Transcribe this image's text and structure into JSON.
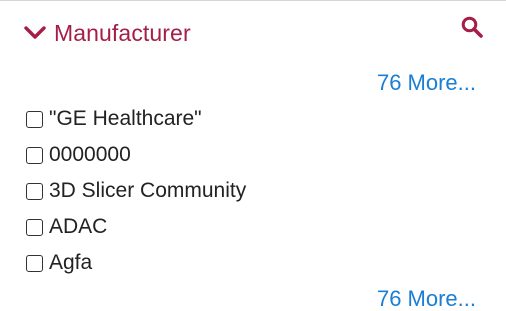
{
  "facet": {
    "title": "Manufacturer",
    "toggle_icon": "chevron-down-icon",
    "search_icon": "search-icon",
    "accent_color": "#a41e47",
    "link_color": "#1a7fd4",
    "more_top_label": "76 More...",
    "more_bottom_label": "76 More...",
    "items": [
      {
        "label": "\"GE Healthcare\"",
        "checked": false
      },
      {
        "label": "0000000",
        "checked": false
      },
      {
        "label": "3D Slicer Community",
        "checked": false
      },
      {
        "label": "ADAC",
        "checked": false
      },
      {
        "label": "Agfa",
        "checked": false
      }
    ]
  }
}
